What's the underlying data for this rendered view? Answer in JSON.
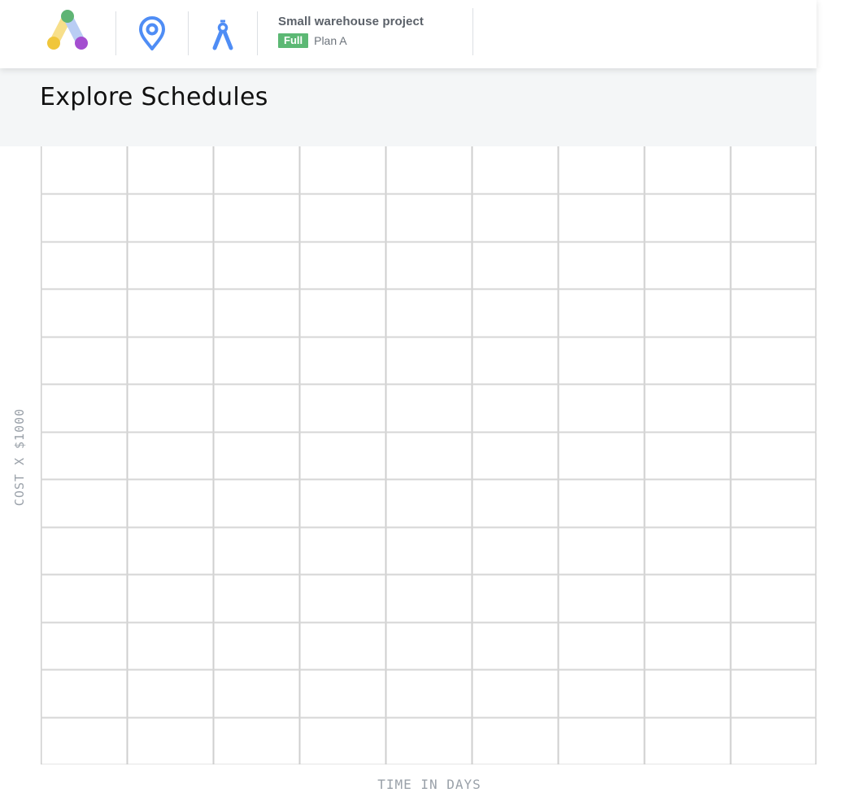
{
  "header": {
    "project_title": "Small warehouse project",
    "scope_badge": "Full",
    "plan_name": "Plan A"
  },
  "icons": {
    "logo": "app-logo",
    "location": "map-pin-icon",
    "drafting": "compass-icon"
  },
  "page": {
    "title": "Explore Schedules"
  },
  "chart": {
    "y_axis_label": "COST X $1000",
    "x_axis_label": "TIME IN DAYS",
    "columns": 9,
    "rows": 13
  },
  "colors": {
    "badge": "#5cb874",
    "icon_blue": "#4f8df5",
    "header_band": "#f4f6f7",
    "axis_label": "#9aa1a9"
  }
}
